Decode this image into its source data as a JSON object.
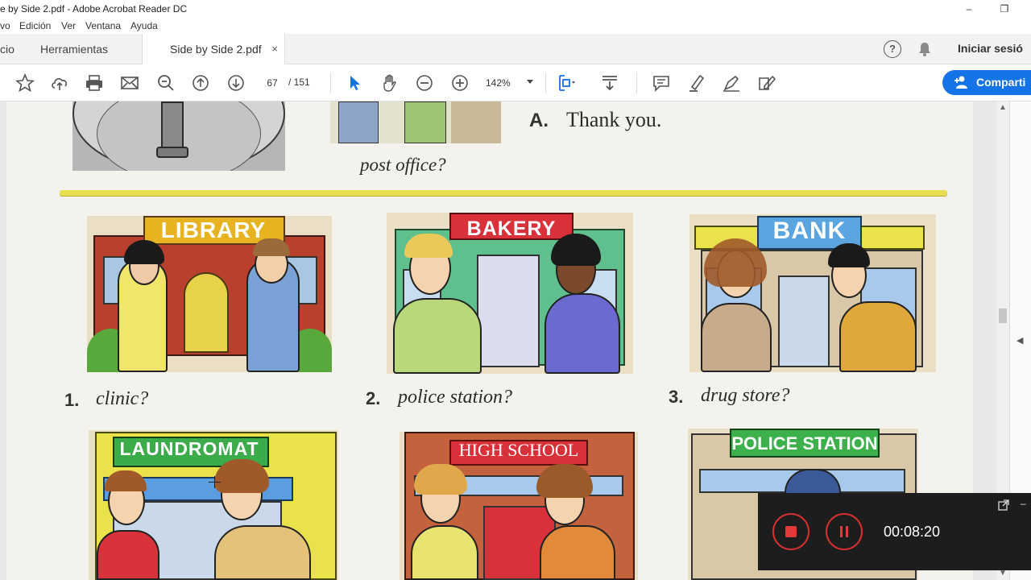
{
  "window": {
    "title": "e by Side 2.pdf - Adobe Acrobat Reader DC",
    "minimize": "–",
    "restore": "❐"
  },
  "menu": [
    "vo",
    "Edición",
    "Ver",
    "Ventana",
    "Ayuda"
  ],
  "tabs": {
    "home": "cio",
    "tools": "Herramientas",
    "document": "Side by Side 2.pdf",
    "close": "×"
  },
  "header": {
    "help": "?",
    "signin": "Iniciar sesió"
  },
  "toolbar": {
    "page_current": "67",
    "page_total": "/  151",
    "zoom": "142%",
    "share": "Comparti",
    "icons": [
      "star-icon",
      "upload-icon",
      "print-icon",
      "mail-icon",
      "search-icon",
      "page-up-icon",
      "page-down-icon",
      "select-arrow-icon",
      "hand-icon",
      "zoom-out-icon",
      "zoom-in-icon",
      "fit-page-icon",
      "scroll-mode-icon",
      "comment-icon",
      "highlight-icon",
      "sign-icon",
      "fill-sign-icon"
    ]
  },
  "document": {
    "answer_letter": "A.",
    "answer_text": "Thank you.",
    "prev_question": "post office?",
    "scenes": [
      {
        "sign": "LIBRARY",
        "num": "1.",
        "question": "clinic?"
      },
      {
        "sign": "BAKERY",
        "num": "2.",
        "question": "police station?"
      },
      {
        "sign": "BANK",
        "num": "3.",
        "question": "drug store?"
      },
      {
        "sign": "LAUNDROMAT"
      },
      {
        "sign": "HIGH SCHOOL"
      },
      {
        "sign": "POLICE STATION"
      }
    ]
  },
  "recorder": {
    "time": "00:08:20"
  },
  "colors": {
    "accent": "#1473e6",
    "rule": "#e6df52",
    "record": "#e23b3b"
  }
}
